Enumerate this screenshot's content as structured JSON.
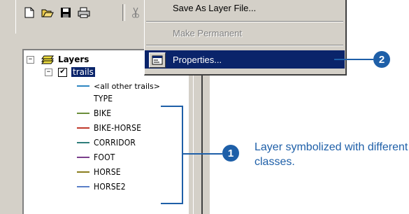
{
  "menu": {
    "items": [
      {
        "label": "Save As Layer File...",
        "state": "normal"
      },
      {
        "label": "Make Permanent",
        "state": "disabled"
      },
      {
        "label": "Properties...",
        "state": "highlighted"
      }
    ]
  },
  "toolbar": {
    "buttons": [
      "new-document-icon",
      "open-icon",
      "save-icon",
      "print-icon",
      "cut-icon"
    ]
  },
  "toc": {
    "root": {
      "label": "Layers",
      "expander": "−"
    },
    "layer": {
      "label": "trails",
      "expander": "−",
      "checked": true
    },
    "default_class": "<all other trails>",
    "field_name": "TYPE",
    "classes": [
      {
        "label": "BIKE",
        "color": "#6b8e3a"
      },
      {
        "label": "BIKE-HORSE",
        "color": "#c0392b"
      },
      {
        "label": "CORRIDOR",
        "color": "#2e7d7a"
      },
      {
        "label": "FOOT",
        "color": "#7b3f8c"
      },
      {
        "label": "HORSE",
        "color": "#8a7d1e"
      },
      {
        "label": "HORSE2",
        "color": "#5a7fc8"
      }
    ],
    "default_class_color": "#2e86c1"
  },
  "callouts": {
    "one": {
      "number": "1",
      "text": "Layer symbolized with different classes."
    },
    "two": {
      "number": "2"
    }
  },
  "colors": {
    "callout": "#1e5fa8",
    "menu_highlight": "#0a246a"
  }
}
